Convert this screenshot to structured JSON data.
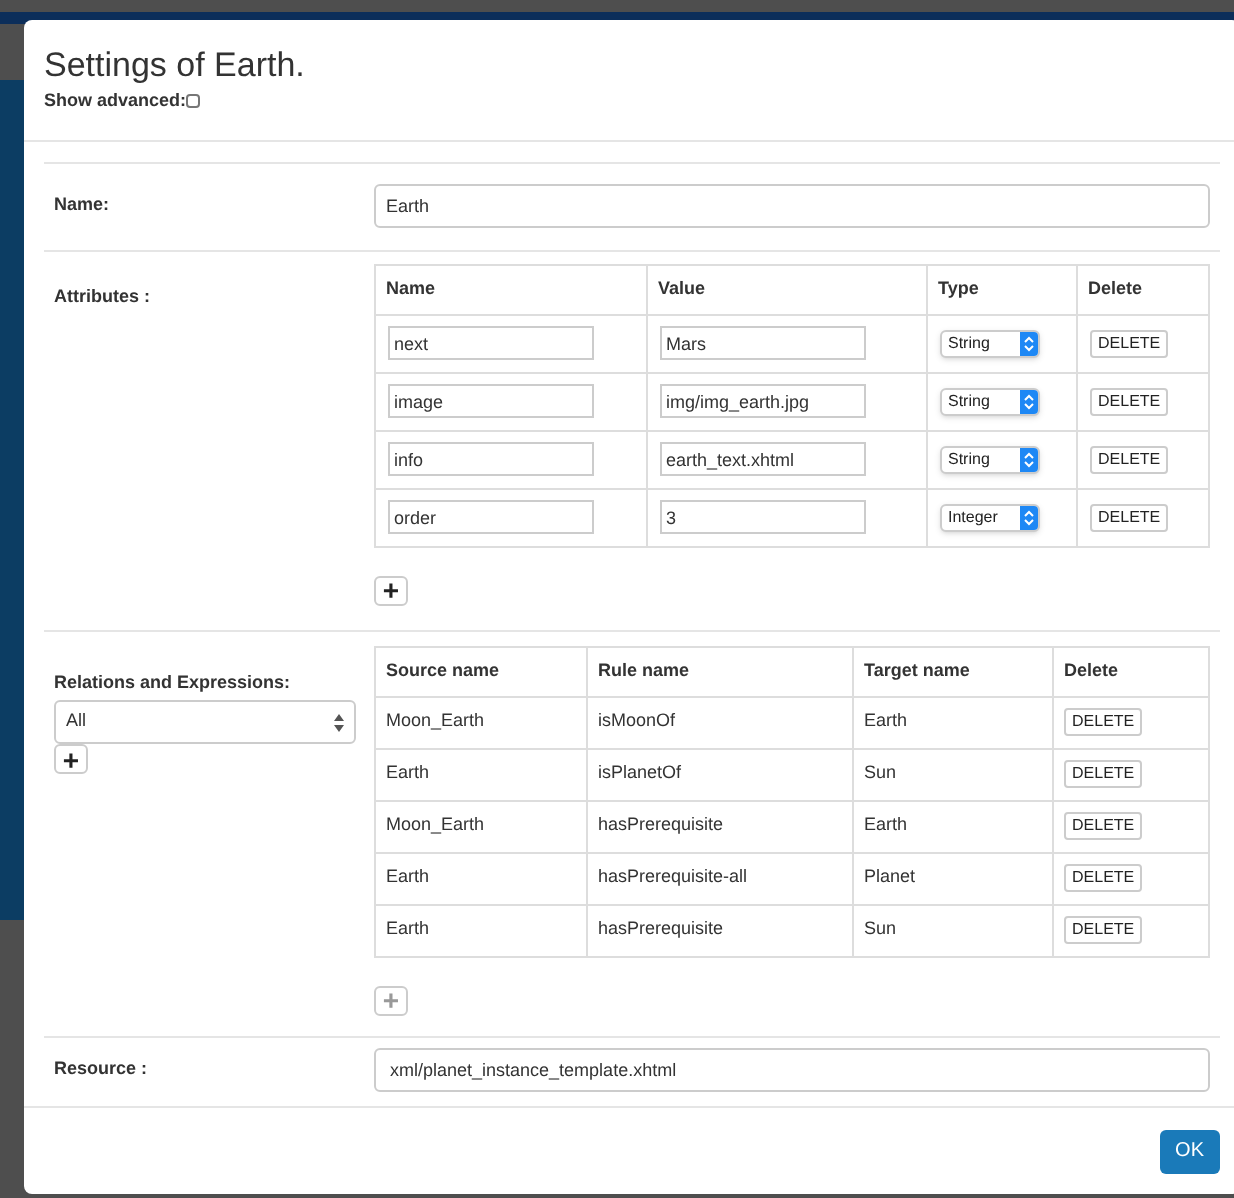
{
  "dialog": {
    "title": "Settings of Earth.",
    "show_advanced": {
      "label": "Show advanced:",
      "checked": false
    }
  },
  "name_field": {
    "label": "Name:",
    "value": "Earth"
  },
  "attributes": {
    "label": "Attributes :",
    "columns": [
      "Name",
      "Value",
      "Type",
      "Delete"
    ],
    "rows": [
      {
        "name": "next",
        "value": "Mars",
        "type": "String",
        "action": "DELETE"
      },
      {
        "name": "image",
        "value": "img/img_earth.jpg",
        "type": "String",
        "action": "DELETE"
      },
      {
        "name": "info",
        "value": "earth_text.xhtml",
        "type": "String",
        "action": "DELETE"
      },
      {
        "name": "order",
        "value": "3",
        "type": "Integer",
        "action": "DELETE"
      }
    ],
    "add_button": {
      "label": "+",
      "disabled": false
    }
  },
  "relations": {
    "label": "Relations and Expressions:",
    "filter": "All",
    "filter_add_button": {
      "label": "+",
      "disabled": false
    },
    "columns": [
      "Source name",
      "Rule name",
      "Target name",
      "Delete"
    ],
    "rows": [
      {
        "source": "Moon_Earth",
        "rule": "isMoonOf",
        "target": "Earth",
        "action": "DELETE"
      },
      {
        "source": "Earth",
        "rule": "isPlanetOf",
        "target": "Sun",
        "action": "DELETE"
      },
      {
        "source": "Moon_Earth",
        "rule": "hasPrerequisite",
        "target": "Earth",
        "action": "DELETE"
      },
      {
        "source": "Earth",
        "rule": "hasPrerequisite-all",
        "target": "Planet",
        "action": "DELETE"
      },
      {
        "source": "Earth",
        "rule": "hasPrerequisite",
        "target": "Sun",
        "action": "DELETE"
      }
    ],
    "add_button": {
      "label": "+",
      "disabled": true
    }
  },
  "resource_field": {
    "label": "Resource :",
    "value": "xml/planet_instance_template.xhtml"
  },
  "footer": {
    "ok_button": "OK"
  }
}
